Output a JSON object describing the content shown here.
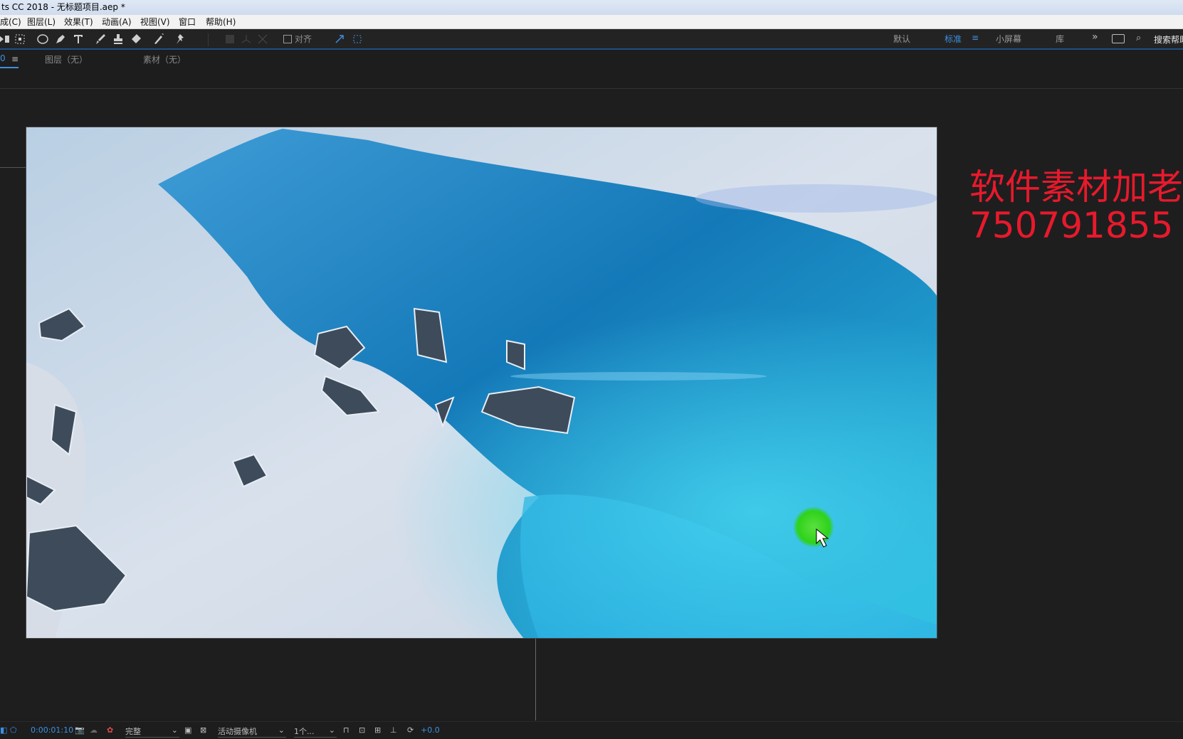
{
  "window": {
    "title": "ts CC 2018 - 无标题项目.aep *"
  },
  "menu": [
    "成(C)",
    "图层(L)",
    "效果(T)",
    "动画(A)",
    "视图(V)",
    "窗口",
    "帮助(H)"
  ],
  "toolbar": {
    "align_label": "对齐",
    "workspaces": [
      "默认",
      "标准",
      "小屏幕",
      "库"
    ],
    "active_workspace": "标准",
    "search_label": "搜索帮助"
  },
  "panels": {
    "composition_tab": "0",
    "layer_tab": "图层（无）",
    "footage_tab": "素材（无）"
  },
  "overlay": {
    "watermark_line1": "软件素材加老",
    "watermark_line2": "750791855"
  },
  "viewer_bar": {
    "timecode": "0:00:01:10",
    "resolution": "完整",
    "camera": "活动摄像机",
    "views": "1个...",
    "exposure": "+0.0"
  },
  "colors": {
    "accent": "#3d8fe0",
    "watermark": "#e8192c",
    "cursor_highlight": "#2fd21a"
  }
}
